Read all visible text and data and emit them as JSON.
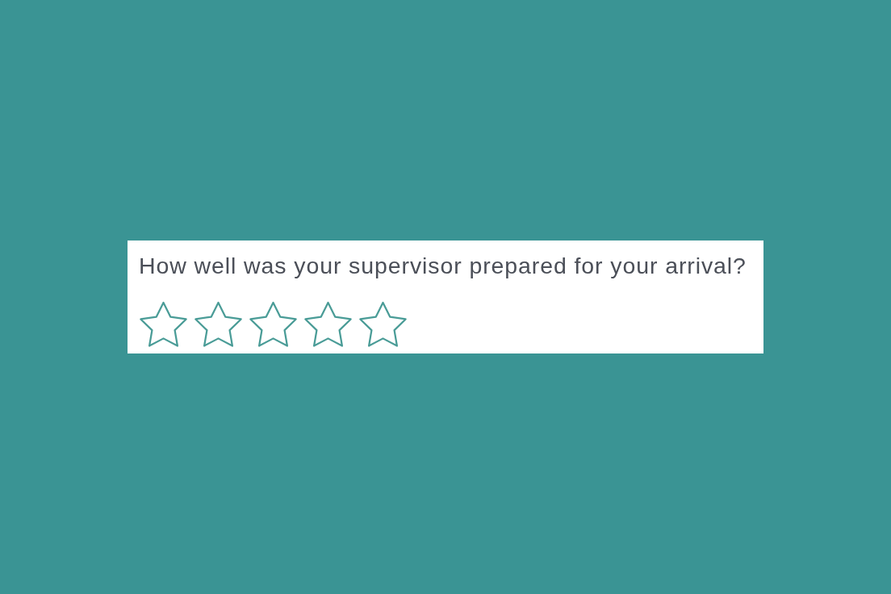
{
  "survey_card": {
    "question": "How well was your supervisor prepared for your arrival?",
    "rating": {
      "stars": 0
    }
  }
}
